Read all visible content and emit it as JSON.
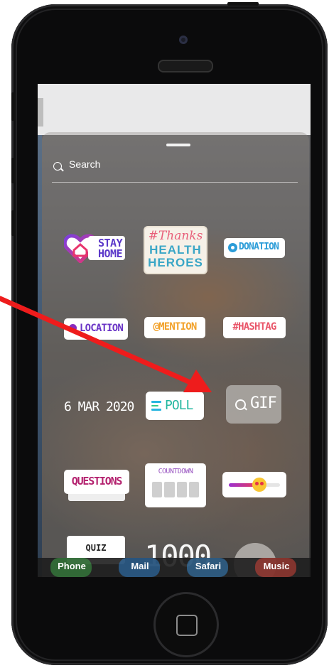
{
  "search": {
    "placeholder": "Search"
  },
  "stickers": {
    "stay_home": {
      "line1": "STAY",
      "line2": "HOME"
    },
    "thanks": {
      "line1": "#Thanks",
      "line2": "HEALTH",
      "line3": "HEROES"
    },
    "donation": "DONATION",
    "location": "LOCATION",
    "mention": "@MENTION",
    "hashtag": "#HASHTAG",
    "date": "6 MAR 2020",
    "poll": "POLL",
    "gif": "GIF",
    "questions": "QUESTIONS",
    "countdown": "COUNTDOWN",
    "quiz": "QUIZ",
    "year": "1000"
  },
  "dock": [
    "Phone",
    "Mail",
    "Safari",
    "Music"
  ],
  "colors": {
    "annotation_arrow": "#ee1c1c",
    "dock_phone": "#3fae4a",
    "dock_mail": "#2f86d6",
    "dock_safari": "#3a8fd8",
    "dock_music": "#e2463a"
  }
}
